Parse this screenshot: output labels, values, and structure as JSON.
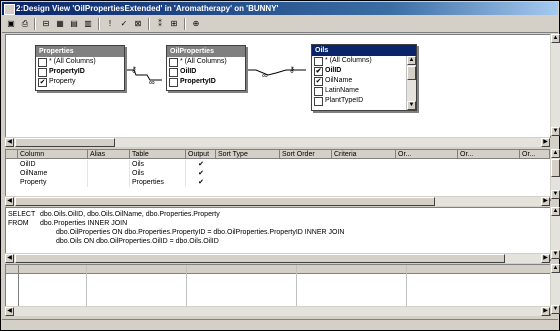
{
  "window": {
    "title": "2:Design View 'OilPropertiesExtended' in 'Aromatherapy' on 'BUNNY'"
  },
  "toolbar": {
    "icons": [
      "save-icon",
      "print-icon",
      "diagram-pane-icon",
      "grid-pane-icon",
      "sql-pane-icon",
      "results-pane-icon",
      "run-icon",
      "verify-sql-icon",
      "remove-filter-icon",
      "use-group-by-icon",
      "add-table-icon"
    ]
  },
  "diagram": {
    "tables": [
      {
        "name": "Properties",
        "active": false,
        "columns": [
          {
            "label": "* (All Columns)",
            "checked": false,
            "bold": false
          },
          {
            "label": "PropertyID",
            "checked": false,
            "bold": true
          },
          {
            "label": "Property",
            "checked": true,
            "bold": false
          }
        ]
      },
      {
        "name": "OilProperties",
        "active": false,
        "columns": [
          {
            "label": "* (All Columns)",
            "checked": false,
            "bold": false
          },
          {
            "label": "OilID",
            "checked": false,
            "bold": true
          },
          {
            "label": "PropertyID",
            "checked": false,
            "bold": true
          }
        ]
      },
      {
        "name": "Oils",
        "active": true,
        "columns": [
          {
            "label": "* (All Columns)",
            "checked": false,
            "bold": false
          },
          {
            "label": "OilID",
            "checked": true,
            "bold": true
          },
          {
            "label": "OilName",
            "checked": true,
            "bold": false
          },
          {
            "label": "LatinName",
            "checked": false,
            "bold": false
          },
          {
            "label": "PlantTypeID",
            "checked": false,
            "bold": false
          }
        ]
      }
    ]
  },
  "grid": {
    "headers": [
      "Column",
      "Alias",
      "Table",
      "Output",
      "Sort Type",
      "Sort Order",
      "Criteria",
      "Or...",
      "Or...",
      "Or..."
    ],
    "rows": [
      {
        "column": "OilID",
        "alias": "",
        "table": "Oils",
        "output": "✔"
      },
      {
        "column": "OilName",
        "alias": "",
        "table": "Oils",
        "output": "✔"
      },
      {
        "column": "Property",
        "alias": "",
        "table": "Properties",
        "output": "✔"
      }
    ]
  },
  "sql": {
    "lines": [
      {
        "kw": "SELECT",
        "text": "dbo.Oils.OilID, dbo.Oils.OilName, dbo.Properties.Property"
      },
      {
        "kw": "FROM",
        "text": "dbo.Properties INNER JOIN"
      },
      {
        "kw": "",
        "text": "dbo.OilProperties ON dbo.Properties.PropertyID = dbo.OilProperties.PropertyID INNER JOIN"
      },
      {
        "kw": "",
        "text": "dbo.Oils ON dbo.OilProperties.OilID = dbo.Oils.OilID"
      }
    ]
  }
}
